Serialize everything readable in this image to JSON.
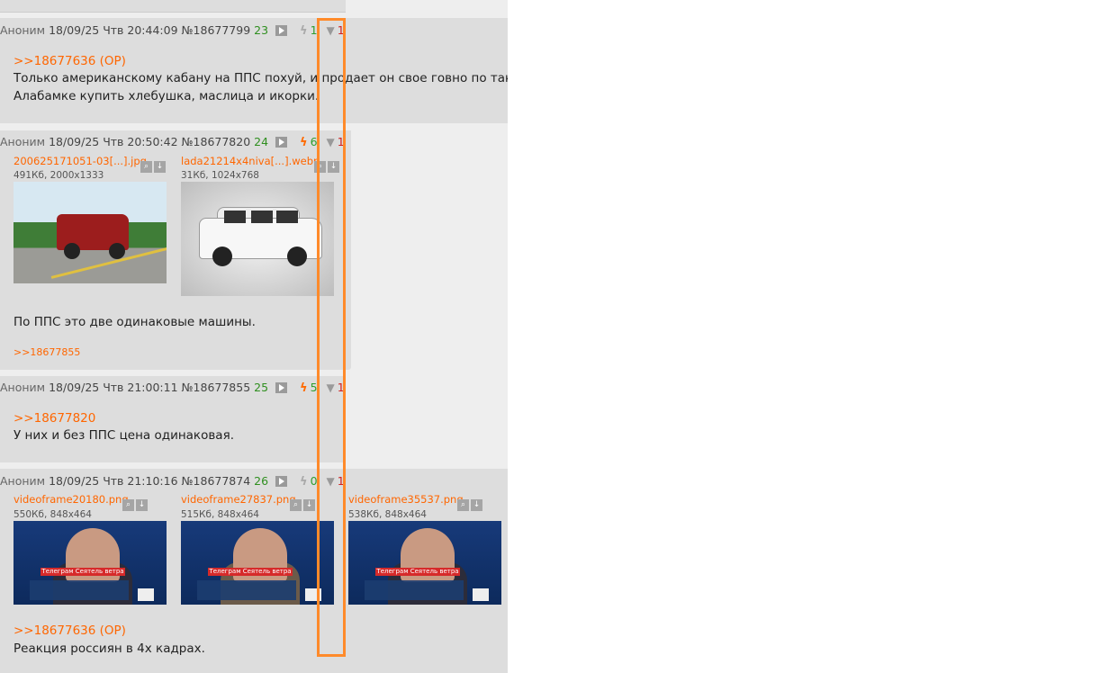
{
  "posts": [
    {
      "author": "Аноним",
      "date": "18/09/25 Чтв 20:44:09",
      "number": "№18677799",
      "index": "23",
      "likes": "1",
      "dislikes": "1",
      "reply_link": ">>18677636 (OP)",
      "text_lines": [
        "Только американскому кабану на ППС похуй, и продает он свое говно по таким",
        "Алабамке купить хлебушка, маслица и икорки."
      ]
    },
    {
      "author": "Аноним",
      "date": "18/09/25 Чтв 20:50:42",
      "number": "№18677820",
      "index": "24",
      "likes": "6",
      "dislikes": "1",
      "files": [
        {
          "name": "200625171051-03[...].jpg",
          "meta": "491Кб, 2000x1333"
        },
        {
          "name": "lada21214x4niva[...].webp",
          "meta": "31Кб, 1024x768"
        }
      ],
      "text_lines": [
        "По ППС это две одинаковые машины."
      ],
      "backlink": ">>18677855"
    },
    {
      "author": "Аноним",
      "date": "18/09/25 Чтв 21:00:11",
      "number": "№18677855",
      "index": "25",
      "likes": "5",
      "dislikes": "1",
      "reply_link": ">>18677820",
      "text_lines": [
        "У них и без ППС цена одинаковая."
      ]
    },
    {
      "author": "Аноним",
      "date": "18/09/25 Чтв 21:10:16",
      "number": "№18677874",
      "index": "26",
      "likes": "0",
      "dislikes": "1",
      "files": [
        {
          "name": "videoframe20180.png",
          "meta": "550Кб, 848x464"
        },
        {
          "name": "videoframe27837.png",
          "meta": "515Кб, 848x464"
        },
        {
          "name": "videoframe35537.png",
          "meta": "538Кб, 848x464"
        }
      ],
      "tv_caption": "Телеграм Сеятель ветра",
      "reply_link": ">>18677636 (OP)",
      "text_lines": [
        "Реакция россиян в 4х кадрах."
      ]
    }
  ],
  "icons": {
    "play": "play-icon",
    "bolt": "bolt-icon",
    "thumb": "thumbs-down-icon",
    "search": "search-icon",
    "download": "download-icon"
  },
  "colors": {
    "accent": "#ff6600",
    "highlight": "#ff8a2a",
    "likes": "#2e9e2e",
    "dislikes": "#d02020"
  }
}
